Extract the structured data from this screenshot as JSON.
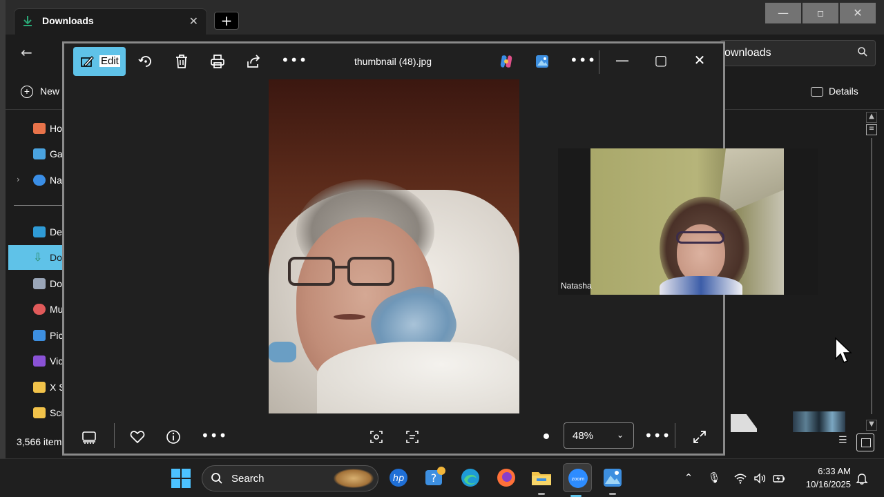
{
  "explorer": {
    "tab_title": "Downloads",
    "new_tab_label": "+",
    "new_label": "New",
    "search_value": "ownloads",
    "details_label": "Details",
    "item_count": "3,566 item",
    "nav_items": [
      {
        "label": "Ho",
        "icon": "home-icon",
        "color": "#e8734a"
      },
      {
        "label": "Ga",
        "icon": "gallery-icon",
        "color": "#4aa3df"
      },
      {
        "label": "Na",
        "icon": "onedrive-icon",
        "color": "#3a8ee6"
      },
      {
        "label": "De",
        "icon": "desktop-icon",
        "color": "#2f9bd6"
      },
      {
        "label": "Do",
        "icon": "downloads-icon",
        "color": "#2aa876"
      },
      {
        "label": "Do",
        "icon": "documents-icon",
        "color": "#9aa6b8"
      },
      {
        "label": "Mu",
        "icon": "music-icon",
        "color": "#e05a5a"
      },
      {
        "label": "Pic",
        "icon": "pictures-icon",
        "color": "#3d8fe0"
      },
      {
        "label": "Vic",
        "icon": "videos-icon",
        "color": "#8a52d6"
      },
      {
        "label": "X S",
        "icon": "folder-icon",
        "color": "#f2c34a"
      },
      {
        "label": "Scr",
        "icon": "folder-icon",
        "color": "#f2c34a"
      }
    ]
  },
  "photos": {
    "edit_label": "Edit",
    "file_title": "thumbnail (48).jpg",
    "zoom_value": "48%",
    "participant_name": "Natasha"
  },
  "taskbar": {
    "search_label": "Search",
    "time": "6:33 AM",
    "date": "10/16/2025"
  },
  "colors": {
    "accent": "#5fc2e8",
    "window_bg": "#202020",
    "explorer_bg": "#1c1c1c"
  }
}
